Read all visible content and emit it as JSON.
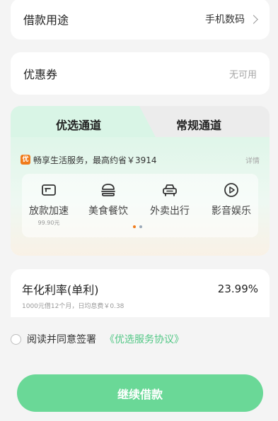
{
  "purpose": {
    "label": "借款用途",
    "value": "手机数码"
  },
  "coupon": {
    "label": "优惠券",
    "value": "无可用"
  },
  "channel": {
    "tabs": [
      {
        "label": "优选通道",
        "active": true
      },
      {
        "label": "常规通道",
        "active": false
      }
    ],
    "promo": {
      "badge": "优",
      "text": "畅享生活服务，最高约省￥3914",
      "link": "详情"
    },
    "services": [
      {
        "label": "放款加速",
        "sub": "99.90元",
        "icon": "wallet-icon"
      },
      {
        "label": "美食餐饮",
        "sub": "",
        "icon": "burger-icon"
      },
      {
        "label": "外卖出行",
        "sub": "",
        "icon": "car-icon"
      },
      {
        "label": "影音娱乐",
        "sub": "",
        "icon": "play-icon"
      }
    ],
    "pager": {
      "count": 2,
      "active": 0
    }
  },
  "rate": {
    "label": "年化利率(单利)",
    "value": "23.99%",
    "sub": "1000元借12个月，日均息费￥0.38"
  },
  "agreement": {
    "text": "阅读并同意签署",
    "link": "《优选服务协议》"
  },
  "submit": {
    "label": "继续借款"
  },
  "colors": {
    "accent": "#6ad897",
    "link": "#52c785",
    "badge": "#f07b1a",
    "pager_active": "#f07b1a",
    "pager_inactive": "#9aa8b8"
  }
}
